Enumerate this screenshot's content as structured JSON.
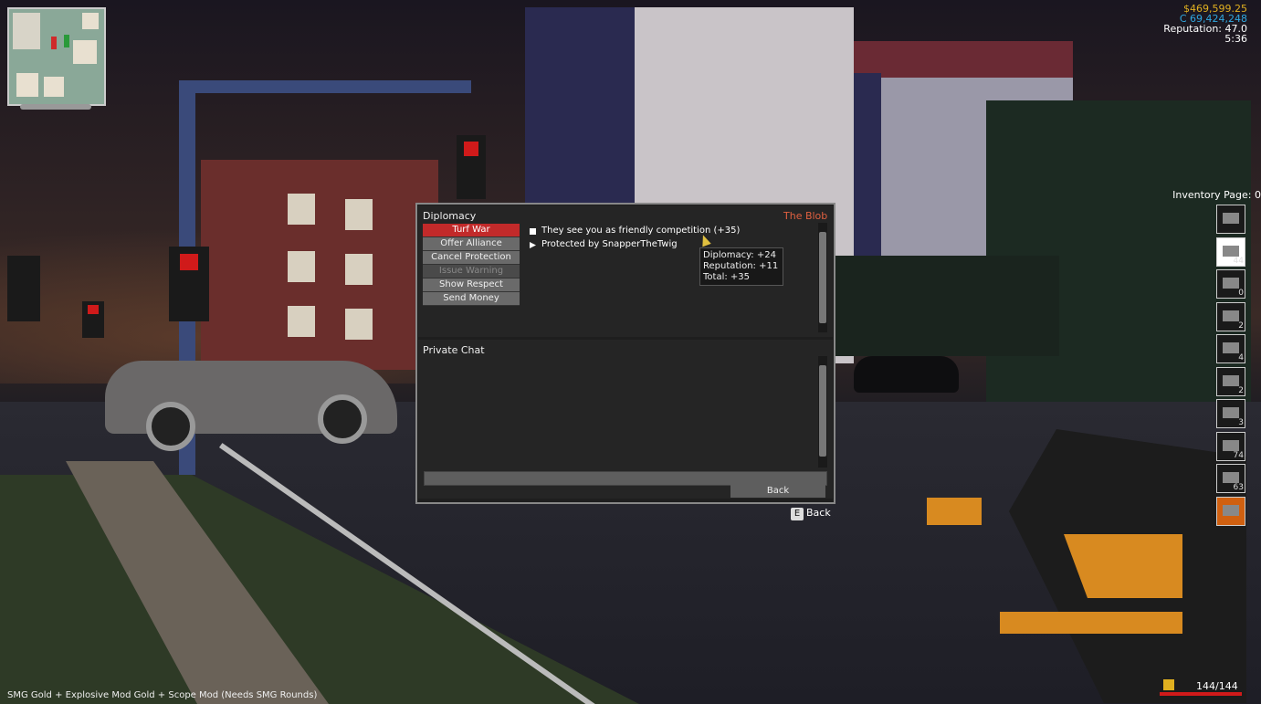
{
  "hud": {
    "money_primary": "$469,599.25",
    "money_secondary": "C 69,424,248",
    "reputation": "Reputation: 47.0",
    "time": "5:36",
    "inventory_label": "Inventory Page: 0",
    "inventory_slots": [
      {
        "icon": "compass-icon",
        "count": ""
      },
      {
        "icon": "cloth-icon",
        "count": "44"
      },
      {
        "icon": "pistol-icon",
        "count": "0"
      },
      {
        "icon": "rifle-icon",
        "count": "2"
      },
      {
        "icon": "shotgun-icon",
        "count": "4"
      },
      {
        "icon": "knife-icon",
        "count": "2"
      },
      {
        "icon": "bottle-icon",
        "count": "3"
      },
      {
        "icon": "smg-icon",
        "count": "74"
      },
      {
        "icon": "ammo-icon",
        "count": "63"
      },
      {
        "icon": "explosive-icon",
        "count": ""
      }
    ],
    "health": "144/144",
    "status_line": "SMG Gold + Explosive Mod Gold + Scope Mod (Needs SMG Rounds)"
  },
  "dialog": {
    "title": "Diplomacy",
    "faction": "The Blob",
    "actions": [
      {
        "label": "Turf War",
        "state": "active"
      },
      {
        "label": "Offer Alliance",
        "state": "normal"
      },
      {
        "label": "Cancel Protection",
        "state": "normal"
      },
      {
        "label": "Issue Warning",
        "state": "disabled"
      },
      {
        "label": "Show Respect",
        "state": "normal"
      },
      {
        "label": "Send Money",
        "state": "normal"
      }
    ],
    "info": [
      "They see you as friendly competition (+35)",
      "Protected by SnapperTheTwig"
    ],
    "tooltip": {
      "diplomacy": "Diplomacy: +24",
      "reputation": "Reputation: +11",
      "total": "Total: +35"
    },
    "chat_title": "Private Chat",
    "chat_input_value": "",
    "back_button": "Back",
    "key_hint_key": "E",
    "key_hint_label": "Back"
  }
}
